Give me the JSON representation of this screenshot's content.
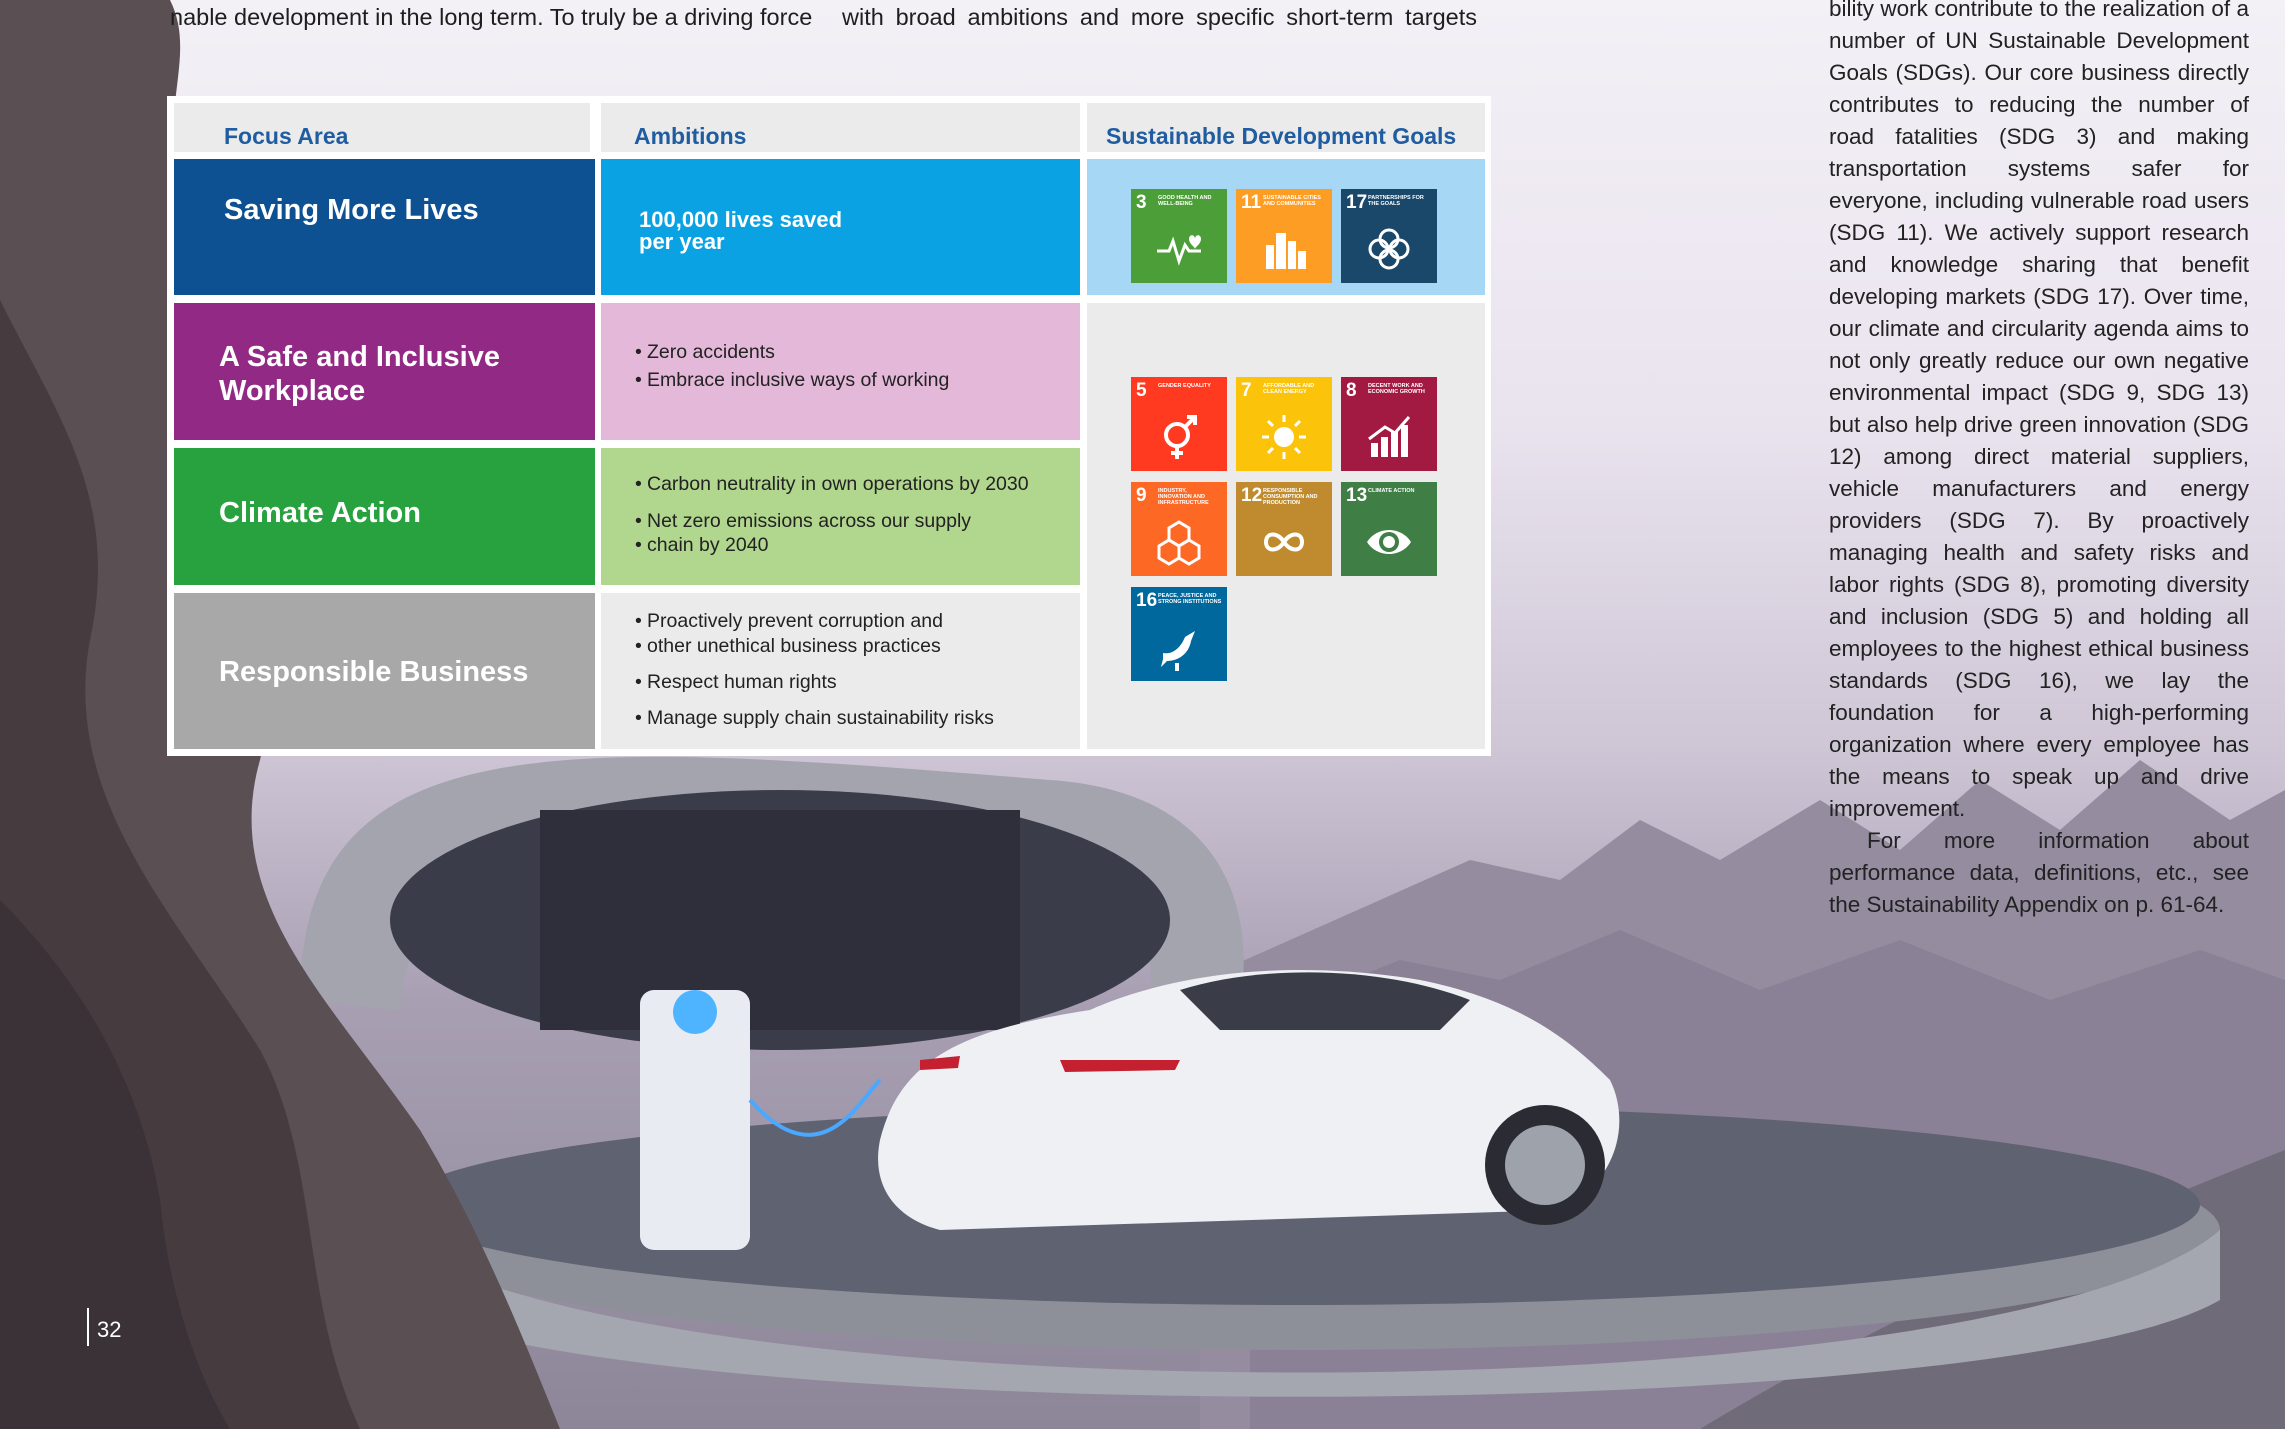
{
  "page": {
    "number": "32",
    "top_left_fragment": "nable development in the long term. To truly be a driving force",
    "top_mid_fragment": "with broad ambitions and more specific short-term targets",
    "right_paragraph_1": "bility work contribute to the realization of a number of UN Sustainable Development Goals (SDGs). Our core business directly contributes to reducing the number of road fatalities (SDG 3) and making transportation systems safer for everyone, including vulnerable road users (SDG 11). We actively support research and knowledge sharing that benefit developing markets (SDG 17). Over time, our climate and circularity agenda aims to not only greatly reduce our own negative environmental impact (SDG 9, SDG 13) but also help drive green innovation (SDG 12) among direct material suppliers, vehicle manufacturers and energy providers (SDG 7). By proactively managing health and safety risks and labor rights (SDG 8), promoting diversity and inclusion (SDG 5) and holding all employees to the highest ethical business standards (SDG 16), we lay the foundation for a high-performing organization where every employee has the means to speak up and drive improvement.",
    "right_paragraph_2": "For more information about performance data, definitions, etc., see the Sustainability Appendix on p. 61-64."
  },
  "table": {
    "headers": [
      "Focus Area",
      "Ambitions",
      "Sustainable Development Goals"
    ],
    "rows": [
      {
        "focus": "Saving More Lives",
        "ambitions": [
          "100,000 lives saved",
          "per year"
        ]
      },
      {
        "focus_lines": [
          "A Safe and Inclusive",
          "Workplace"
        ],
        "ambitions": [
          "Zero accidents",
          "Embrace inclusive ways of working"
        ]
      },
      {
        "focus": "Climate Action",
        "ambitions": [
          "Carbon neutrality in own operations by 2030",
          "Net zero emissions across our supply",
          "chain by 2040"
        ]
      },
      {
        "focus": "Responsible Business",
        "ambitions": [
          "Proactively prevent corruption and",
          "other unethical business practices",
          "Respect human rights",
          "Manage supply chain sustainability risks"
        ]
      }
    ],
    "colors": {
      "header_bg": "#ebebeb",
      "header_text": "#1f5da0",
      "row1_focus": "#0d5193",
      "row1_amb": "#0aa2e3",
      "row1_sdg": "#a6d8f5",
      "row2_focus": "#922a85",
      "row2_amb": "#e4b8d9",
      "row3_focus": "#27a23f",
      "row3_amb": "#b1d68e",
      "row4_focus": "#a8a8a8",
      "row4_amb": "#ebebeb",
      "sdg_bg": "#ebebeb"
    }
  },
  "sdg_tiles": [
    {
      "num": "3",
      "title": "Good health and well-being",
      "color": "#4c9f38",
      "icon": "heartbeat-icon"
    },
    {
      "num": "11",
      "title": "Sustainable cities and communities",
      "color": "#fd9d24",
      "icon": "city-icon"
    },
    {
      "num": "17",
      "title": "Partnerships for the goals",
      "color": "#19486a",
      "icon": "partnership-icon"
    },
    {
      "num": "5",
      "title": "Gender equality",
      "color": "#ff3a21",
      "icon": "gender-icon"
    },
    {
      "num": "7",
      "title": "Affordable and clean energy",
      "color": "#fcc30b",
      "icon": "sun-icon"
    },
    {
      "num": "8",
      "title": "Decent work and economic growth",
      "color": "#a21942",
      "icon": "growth-chart-icon"
    },
    {
      "num": "9",
      "title": "Industry, innovation and infrastructure",
      "color": "#fd6925",
      "icon": "cubes-icon"
    },
    {
      "num": "12",
      "title": "Responsible consumption and production",
      "color": "#bf8b2e",
      "icon": "infinity-icon"
    },
    {
      "num": "13",
      "title": "Climate action",
      "color": "#3f7e44",
      "icon": "eye-globe-icon"
    },
    {
      "num": "16",
      "title": "Peace, justice and strong institutions",
      "color": "#00689d",
      "icon": "dove-icon"
    }
  ]
}
